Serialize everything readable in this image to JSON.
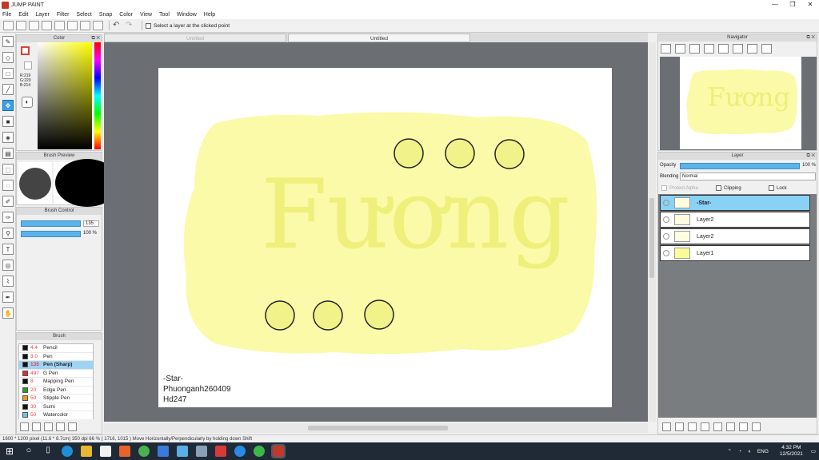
{
  "window": {
    "title": "JUMP PAINT",
    "controls": [
      "—",
      "❐",
      "✕"
    ]
  },
  "menu": [
    "File",
    "Edit",
    "Layer",
    "Filter",
    "Select",
    "Snap",
    "Color",
    "View",
    "Window",
    "Help"
  ],
  "menu_extra": "Tool",
  "toolbar": {
    "checkbox_label": "Select a layer at the clicked point"
  },
  "color_panel": {
    "title": "Color",
    "r": "R:219",
    "g": "G:220",
    "b": "B:214"
  },
  "brush_preview": {
    "title": "Brush Preview"
  },
  "brush_control": {
    "title": "Brush Control",
    "size_value": "135",
    "opacity_value": "100 %",
    "size_fraction": 0.95,
    "opacity_fraction": 1.0
  },
  "brush_panel": {
    "title": "Brush",
    "items": [
      {
        "size": "4.4",
        "name": "Pencil",
        "color": "#111111"
      },
      {
        "size": "3.0",
        "name": "Pen",
        "color": "#111111"
      },
      {
        "size": "135",
        "name": "Pen (Sharp)",
        "color": "#111111"
      },
      {
        "size": "497",
        "name": "G Pen",
        "color": "#e03030"
      },
      {
        "size": "8",
        "name": "Mapping Pen",
        "color": "#111111"
      },
      {
        "size": "20",
        "name": "Edge Pen",
        "color": "#20a020"
      },
      {
        "size": "50",
        "name": "Stipple Pen",
        "color": "#e0a020"
      },
      {
        "size": "30",
        "name": "Sumi",
        "color": "#111111"
      },
      {
        "size": "50",
        "name": "Watercolor",
        "color": "#70c0f0"
      }
    ]
  },
  "tabs": [
    "Untitled",
    "Untitled"
  ],
  "canvas": {
    "word": "Fương",
    "signature": [
      "-Star-",
      "Phuonganh260409",
      "Hd247"
    ],
    "background": "#fafaa8",
    "circle_fill": "#f2f28a"
  },
  "navigator": {
    "title": "Navigator"
  },
  "layer_panel": {
    "title": "Layer",
    "opacity_label": "Opacity",
    "opacity_value": "100 %",
    "blending_label": "Blending",
    "blending_value": "Normal",
    "protect_alpha": "Protect Alpha",
    "clipping": "Clipping",
    "lock": "Lock",
    "layers": [
      "-Star-",
      "Layer2",
      "Layer2",
      "Layer1"
    ]
  },
  "status": "1600 * 1200 pixel   (11.6 * 8.7cm)   350 dpi   66 %   ( 1716, 1015 )   Move Horizontally/Perpendicularly by holding down Shift",
  "taskbar": {
    "lang": "ENG",
    "time": "4:32 PM",
    "date": "12/5/2021"
  }
}
